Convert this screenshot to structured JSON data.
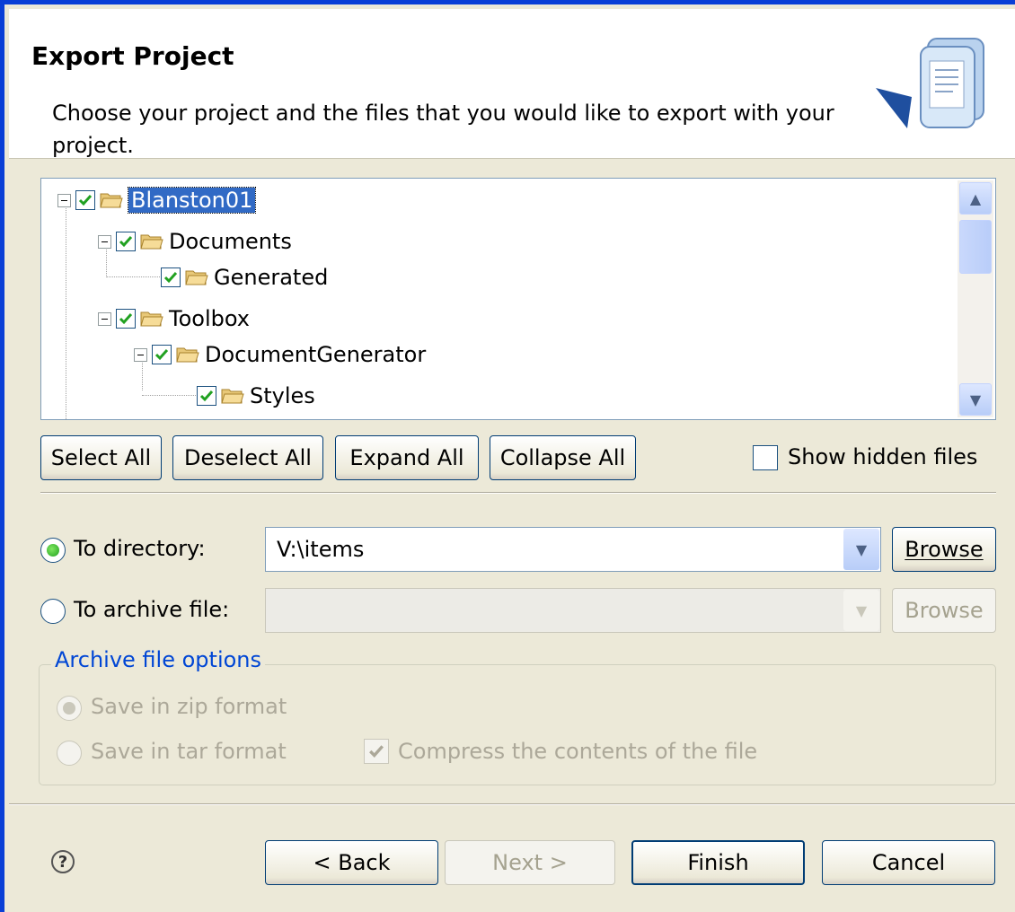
{
  "header": {
    "title": "Export Project",
    "description": "Choose your project and the files that you would like to export with your project."
  },
  "tree": {
    "items": [
      {
        "label": "Blanston01",
        "checked": true,
        "expanded": true,
        "selected": true
      },
      {
        "label": "Documents",
        "checked": true,
        "expanded": true
      },
      {
        "label": "Generated",
        "checked": true
      },
      {
        "label": "Toolbox",
        "checked": true,
        "expanded": true
      },
      {
        "label": "DocumentGenerator",
        "checked": true,
        "expanded": true
      },
      {
        "label": "Styles",
        "checked": true
      }
    ]
  },
  "tree_buttons": {
    "select_all": "Select All",
    "deselect_all": "Deselect All",
    "expand_all": "Expand All",
    "collapse_all": "Collapse All",
    "show_hidden": "Show hidden files",
    "show_hidden_checked": false
  },
  "destination": {
    "to_directory_label": "To directory:",
    "to_directory_value": "V:\\items",
    "to_directory_selected": true,
    "browse_label": "Browse",
    "to_archive_label": "To archive file:",
    "to_archive_value": "",
    "archive_browse_label": "Browse"
  },
  "archive_options": {
    "title": "Archive file options",
    "zip": "Save in zip format",
    "tar": "Save in tar format",
    "compress": "Compress the contents of the file"
  },
  "footer": {
    "back": "< Back",
    "next": "Next >",
    "finish": "Finish",
    "cancel": "Cancel"
  },
  "colors": {
    "accent": "#316ac5",
    "frame": "#0a3fd6",
    "radio_green": "#21a121"
  }
}
